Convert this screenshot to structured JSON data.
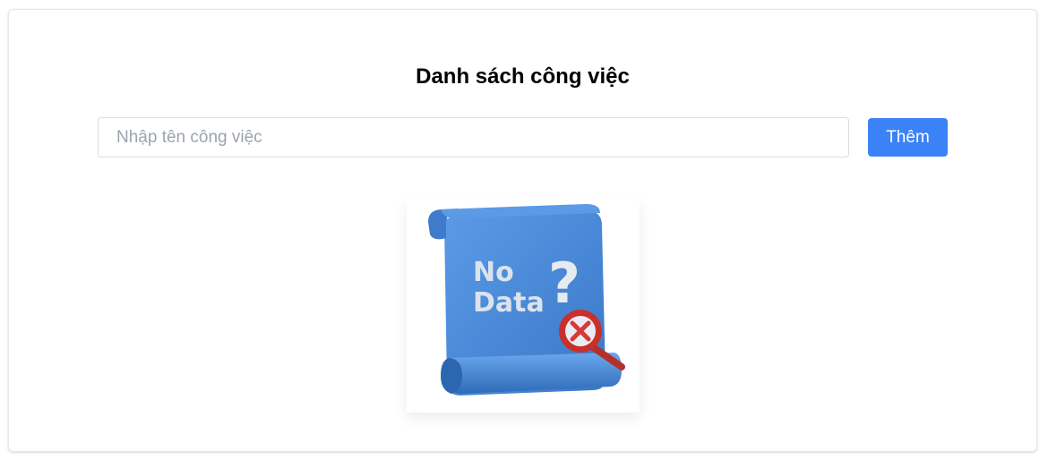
{
  "page": {
    "title": "Danh sách công việc"
  },
  "task_form": {
    "input_value": "",
    "input_placeholder": "Nhập tên công việc",
    "add_button_label": "Thêm"
  },
  "empty_state": {
    "illustration": "no-data-scroll-illustration",
    "line1": "No",
    "line2": "Data",
    "symbol": "?"
  },
  "colors": {
    "accent": "#3b82f6",
    "scroll_blue": "#4a8ddb",
    "magnifier_red": "#d63a36"
  }
}
